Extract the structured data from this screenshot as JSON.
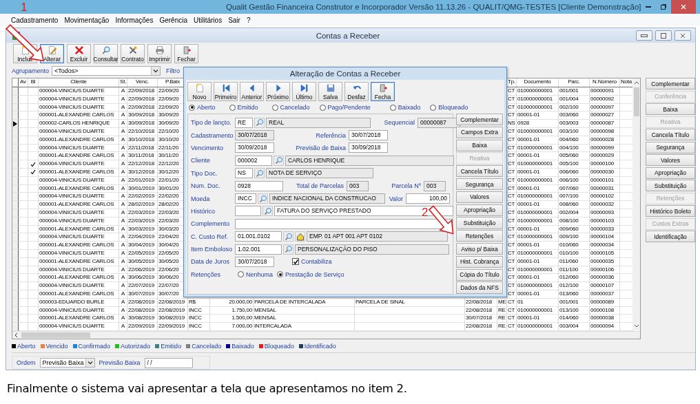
{
  "window": {
    "title": "Qualit Gestão Financeira Construtor e Incorporador Versão 11.13.26 - QUALIT/QMG-TESTES [Cliente Demonstração]"
  },
  "menu": [
    "Cadastramento",
    "Movimentação",
    "Informações",
    "Gerência",
    "Utilitários",
    "Sair",
    "?"
  ],
  "child_window": {
    "title": "Contas a Receber"
  },
  "toolbar": [
    {
      "label": "Incluir",
      "focused": false
    },
    {
      "label": "Alterar",
      "focused": true
    },
    {
      "label": "Excluir",
      "focused": false
    },
    {
      "label": "Consultar",
      "focused": false
    },
    {
      "label": "Contrato",
      "focused": false
    },
    {
      "label": "Imprimir",
      "focused": false
    },
    {
      "label": "Fechar",
      "focused": false
    }
  ],
  "filter": {
    "label": "Agrupamento",
    "value": "<Todos>",
    "filter_label": "Filtro"
  },
  "table": {
    "columns": [
      "Av",
      "Bl",
      "Cliente",
      "St.",
      "Venc.",
      "P.Baix",
      "",
      "",
      "",
      "",
      "",
      "",
      "Tp.",
      "Documento",
      "Parc.",
      "N.Número",
      "Nota"
    ],
    "rows": [
      {
        "selected": false,
        "blocked": false,
        "cells": [
          "",
          "",
          "000004-VINICIUS DUARTE",
          "A",
          "22/09/2018",
          "22/09/20",
          "",
          "",
          "",
          "",
          "",
          "",
          "CT",
          "010000000001",
          "001/001",
          "00000091"
        ]
      },
      {
        "selected": false,
        "blocked": false,
        "cells": [
          "",
          "",
          "000004-VINICIUS DUARTE",
          "A",
          "22/09/2018",
          "22/09/20",
          "",
          "",
          "",
          "",
          "",
          "",
          "CT",
          "010000000001",
          "001/004",
          "00000092"
        ]
      },
      {
        "selected": false,
        "blocked": false,
        "cells": [
          "",
          "",
          "000004-VINICIUS DUARTE",
          "A",
          "22/09/2018",
          "22/09/20",
          "",
          "",
          "",
          "",
          "",
          "",
          "CT",
          "010000000001",
          "002/100",
          "00000097"
        ]
      },
      {
        "selected": false,
        "blocked": false,
        "cells": [
          "",
          "",
          "000001-ALEXANDRE CARLOS",
          "A",
          "30/09/2018",
          "30/09/20",
          "",
          "",
          "",
          "",
          "",
          "",
          "CT",
          "00001-01",
          "003/060",
          "00000027"
        ]
      },
      {
        "selected": true,
        "blocked": false,
        "cells": [
          "",
          "",
          "000002-CARLOS HENRIQUE",
          "A",
          "30/09/2018",
          "30/09/20",
          "",
          "",
          "",
          "",
          "",
          "",
          "NS",
          "0928",
          "003/003",
          "00000087"
        ]
      },
      {
        "selected": false,
        "blocked": false,
        "cells": [
          "",
          "",
          "000004-VINICIUS DUARTE",
          "A",
          "22/10/2018",
          "22/10/20",
          "",
          "",
          "",
          "",
          "",
          "",
          "CT",
          "010000000001",
          "003/100",
          "00000098"
        ]
      },
      {
        "selected": false,
        "blocked": false,
        "cells": [
          "",
          "",
          "000001-ALEXANDRE CARLOS",
          "A",
          "30/10/2018",
          "30/10/20",
          "",
          "",
          "",
          "",
          "",
          "",
          "CT",
          "00001-01",
          "004/060",
          "00000028"
        ]
      },
      {
        "selected": false,
        "blocked": false,
        "cells": [
          "",
          "",
          "000004-VINICIUS DUARTE",
          "A",
          "22/11/2018",
          "22/11/20",
          "",
          "",
          "",
          "",
          "",
          "",
          "CT",
          "010000000001",
          "004/100",
          "00000099"
        ]
      },
      {
        "selected": false,
        "blocked": false,
        "cells": [
          "",
          "",
          "000001-ALEXANDRE CARLOS",
          "A",
          "30/11/2018",
          "30/11/20",
          "",
          "",
          "",
          "",
          "",
          "",
          "CT",
          "00001-01",
          "005/060",
          "00000029"
        ]
      },
      {
        "selected": false,
        "blocked": true,
        "cells": [
          "",
          "",
          "000004-VINICIUS DUARTE",
          "A",
          "22/12/2018",
          "22/12/20",
          "",
          "",
          "",
          "",
          "",
          "",
          "CT",
          "010000000001",
          "005/100",
          "00000100"
        ]
      },
      {
        "selected": false,
        "blocked": true,
        "cells": [
          "",
          "",
          "000001-ALEXANDRE CARLOS",
          "A",
          "30/12/2018",
          "30/12/20",
          "",
          "",
          "",
          "",
          "",
          "",
          "CT",
          "00001-01",
          "006/060",
          "00000030"
        ]
      },
      {
        "selected": false,
        "blocked": false,
        "cells": [
          "",
          "",
          "000004-VINICIUS DUARTE",
          "A",
          "22/01/2019",
          "22/01/20",
          "",
          "",
          "",
          "",
          "",
          "",
          "CT",
          "010000000001",
          "006/100",
          "00000101"
        ]
      },
      {
        "selected": false,
        "blocked": false,
        "cells": [
          "",
          "",
          "000001-ALEXANDRE CARLOS",
          "A",
          "30/01/2019",
          "30/01/20",
          "",
          "",
          "",
          "",
          "",
          "",
          "CT",
          "00001-01",
          "007/060",
          "00000031"
        ]
      },
      {
        "selected": false,
        "blocked": false,
        "cells": [
          "",
          "",
          "000004-VINICIUS DUARTE",
          "A",
          "22/02/2019",
          "22/02/20",
          "",
          "",
          "",
          "",
          "",
          "",
          "CT",
          "010000000001",
          "007/100",
          "00000102"
        ]
      },
      {
        "selected": false,
        "blocked": false,
        "cells": [
          "",
          "",
          "000001-ALEXANDRE CARLOS",
          "A",
          "28/02/2019",
          "28/02/20",
          "",
          "",
          "",
          "",
          "",
          "",
          "CT",
          "00001-01",
          "008/060",
          "00000032"
        ]
      },
      {
        "selected": false,
        "blocked": false,
        "cells": [
          "",
          "",
          "000004-VINICIUS DUARTE",
          "A",
          "22/03/2019",
          "22/03/20",
          "",
          "",
          "",
          "",
          "",
          "",
          "CT",
          "010000000001",
          "002/004",
          "00000093"
        ]
      },
      {
        "selected": false,
        "blocked": false,
        "cells": [
          "",
          "",
          "000004-VINICIUS DUARTE",
          "A",
          "22/03/2019",
          "22/03/20",
          "",
          "",
          "",
          "",
          "",
          "",
          "CT",
          "010000000001",
          "008/100",
          "00000103"
        ]
      },
      {
        "selected": false,
        "blocked": false,
        "cells": [
          "",
          "",
          "000001-ALEXANDRE CARLOS",
          "A",
          "30/03/2019",
          "30/03/20",
          "",
          "",
          "",
          "",
          "",
          "",
          "CT",
          "00001-01",
          "009/060",
          "00000033"
        ]
      },
      {
        "selected": false,
        "blocked": false,
        "cells": [
          "",
          "",
          "000004-VINICIUS DUARTE",
          "A",
          "22/04/2019",
          "22/04/20",
          "",
          "",
          "",
          "",
          "",
          "",
          "CT",
          "010000000001",
          "009/100",
          "00000104"
        ]
      },
      {
        "selected": false,
        "blocked": false,
        "cells": [
          "",
          "",
          "000001-ALEXANDRE CARLOS",
          "A",
          "30/04/2019",
          "30/04/20",
          "",
          "",
          "",
          "",
          "",
          "",
          "CT",
          "00001-01",
          "010/060",
          "00000034"
        ]
      },
      {
        "selected": false,
        "blocked": false,
        "cells": [
          "",
          "",
          "000004-VINICIUS DUARTE",
          "A",
          "22/05/2019",
          "22/05/20",
          "",
          "",
          "",
          "",
          "",
          "",
          "CT",
          "010000000001",
          "010/100",
          "00000105"
        ]
      },
      {
        "selected": false,
        "blocked": false,
        "cells": [
          "",
          "",
          "000001-ALEXANDRE CARLOS",
          "A",
          "30/05/2019",
          "30/05/20",
          "",
          "",
          "",
          "",
          "",
          "",
          "CT",
          "00001-01",
          "011/060",
          "00000035"
        ]
      },
      {
        "selected": false,
        "blocked": false,
        "cells": [
          "",
          "",
          "000004-VINICIUS DUARTE",
          "A",
          "22/06/2019",
          "22/06/20",
          "",
          "",
          "",
          "",
          "",
          "",
          "CT",
          "010000000001",
          "011/100",
          "00000106"
        ]
      },
      {
        "selected": false,
        "blocked": false,
        "cells": [
          "",
          "",
          "000001-ALEXANDRE CARLOS",
          "A",
          "30/06/2019",
          "30/06/20",
          "",
          "",
          "",
          "",
          "",
          "",
          "CT",
          "00001-01",
          "012/060",
          "00000036"
        ]
      },
      {
        "selected": false,
        "blocked": false,
        "cells": [
          "",
          "",
          "000004-VINICIUS DUARTE",
          "A",
          "22/07/2019",
          "22/07/20",
          "",
          "",
          "",
          "",
          "",
          "",
          "CT",
          "010000000001",
          "012/100",
          "00000107"
        ]
      },
      {
        "selected": false,
        "blocked": false,
        "cells": [
          "",
          "",
          "000001-ALEXANDRE CARLOS",
          "A",
          "30/07/2019",
          "30/07/20",
          "",
          "",
          "",
          "",
          "",
          "",
          "CT",
          "00001-01",
          "013/060",
          "00000037"
        ]
      },
      {
        "selected": false,
        "blocked": false,
        "cells": [
          "",
          "",
          "000003-EDUARDO BURLE",
          "A",
          "22/08/2019",
          "22/08/2019",
          "R$",
          "20.000,00",
          "PARCELA DE INTERCALADA",
          "PARCELA DE SINAL",
          "22/08/2018",
          "ME",
          "CT",
          "01",
          "001/001",
          "00000089"
        ]
      },
      {
        "selected": false,
        "blocked": false,
        "cells": [
          "",
          "",
          "000004-VINICIUS DUARTE",
          "A",
          "22/08/2019",
          "22/08/2019",
          "INCC",
          "1.750,00",
          "MENSAL",
          "",
          "22/08/2018",
          "RE",
          "CT",
          "010000000001",
          "013/100",
          "00000108"
        ]
      },
      {
        "selected": false,
        "blocked": false,
        "cells": [
          "",
          "",
          "000001-ALEXANDRE CARLOS",
          "A",
          "30/08/2019",
          "30/08/2019",
          "INCC",
          "1.500,00",
          "MENSAL",
          "",
          "30/07/2018",
          "RE",
          "CT",
          "00001-01",
          "014/060",
          "00000038"
        ]
      },
      {
        "selected": false,
        "blocked": false,
        "cells": [
          "",
          "",
          "000004-VINICIUS DUARTE",
          "A",
          "22/09/2019",
          "22/09/2019",
          "INCC",
          "7.000,00",
          "INTERCALADA",
          "",
          "22/08/2018",
          "RE",
          "CT",
          "010000000001",
          "003/004",
          "00000094"
        ]
      }
    ]
  },
  "side_buttons": [
    {
      "label": "Complementar",
      "disabled": false
    },
    {
      "label": "Conferência",
      "disabled": true
    },
    {
      "label": "Baixa",
      "disabled": false
    },
    {
      "label": "Reativa",
      "disabled": true
    },
    {
      "label": "Cancela Título",
      "disabled": false
    },
    {
      "label": "Segurança",
      "disabled": false
    },
    {
      "label": "Valores",
      "disabled": false
    },
    {
      "label": "Apropriação",
      "disabled": false
    },
    {
      "label": "Substituição",
      "disabled": false
    },
    {
      "label": "Retenções",
      "disabled": true
    },
    {
      "label": "Histórico Boleto",
      "disabled": false
    },
    {
      "label": "Custos Extras",
      "disabled": true
    },
    {
      "label": "Identificação",
      "disabled": false
    }
  ],
  "legend": [
    {
      "label": "Aberto",
      "color": "#000000"
    },
    {
      "label": "Vencido",
      "color": "#f08040"
    },
    {
      "label": "Confirmado",
      "color": "#2080e0"
    },
    {
      "label": "Autorizado",
      "color": "#20c020"
    },
    {
      "label": "Emitido",
      "color": "#408080"
    },
    {
      "label": "Cancelado",
      "color": "#808080"
    },
    {
      "label": "Baixado",
      "color": "#000080"
    },
    {
      "label": "Bloqueado",
      "color": "#e02020"
    },
    {
      "label": "Identificado",
      "color": "#204060"
    }
  ],
  "order": {
    "label": "Ordem",
    "value": "Previsão Baixa",
    "date_label": "Previsão Baixa",
    "date_value": "/ /"
  },
  "dialog": {
    "title": "Alteração de Contas a Receber",
    "toolbar": [
      {
        "label": "Novo",
        "focused": false
      },
      {
        "label": "Primeiro",
        "focused": false
      },
      {
        "label": "Anterior",
        "focused": false
      },
      {
        "label": "Próximo",
        "focused": false
      },
      {
        "label": "Último",
        "focused": false
      },
      {
        "label": "Salva",
        "focused": false
      },
      {
        "label": "Desfaz",
        "focused": false
      },
      {
        "label": "Fecha",
        "focused": true
      }
    ],
    "statuses": [
      {
        "label": "Aberto",
        "selected": true
      },
      {
        "label": "Emitido",
        "selected": false
      },
      {
        "label": "Cancelado",
        "selected": false
      },
      {
        "label": "Pago/Pendente",
        "selected": false
      },
      {
        "label": "Baixado",
        "selected": false
      },
      {
        "label": "Bloqueado",
        "selected": false
      }
    ],
    "form": {
      "tipo_lancto": {
        "label": "Tipo de lançto.",
        "code": "RE",
        "description": "REAL"
      },
      "sequencial": {
        "label": "Sequencial",
        "value": "00000087",
        "readonly": true
      },
      "cadastramento": {
        "label": "Cadastramento",
        "value": "30/07/2018",
        "readonly": true
      },
      "referencia": {
        "label": "Referência",
        "value": "30/07/2018",
        "readonly": false
      },
      "vencimento": {
        "label": "Vencimento",
        "value": "30/09/2018",
        "readonly": false
      },
      "previsao_baixa": {
        "label": "Previsão de Baixa",
        "value": "30/09/2018",
        "readonly": false
      },
      "cliente": {
        "label": "Cliente",
        "code": "000002",
        "description": "CARLOS HENRIQUE"
      },
      "tipo_doc": {
        "label": "Tipo Doc.",
        "code": "NS",
        "description": "NOTA DE SERVIÇO"
      },
      "num_doc": {
        "label": "Num. Doc.",
        "value": "0928",
        "readonly": false
      },
      "total_parcelas": {
        "label": "Total de Parcelas",
        "value": "003",
        "readonly": true
      },
      "parcela": {
        "label": "Parcela Nº",
        "value": "003",
        "readonly": true
      },
      "moeda": {
        "label": "Moeda",
        "code": "INCC",
        "description": "INDICE NACIONAL DA CONSTRUCAO"
      },
      "valor": {
        "label": "Valor",
        "value": "100,00",
        "readonly": false
      },
      "historico": {
        "label": "Histórico",
        "description": "FATURA DO SERVIÇO PRESTADO"
      },
      "complemento": {
        "label": "Complemento"
      },
      "c_custo": {
        "label": "C. Custo Ref.",
        "code": "01.001.0102",
        "description": "EMP. 01 APT 001 APT 0102"
      },
      "item_emboloso": {
        "label": "Item Emboloso",
        "code": "1.02.001",
        "description": "PERSONALIZAÇÃO DO PISO"
      },
      "data_juros": {
        "label": "Data de Juros",
        "value": "30/07/2018",
        "readonly": false
      },
      "contabiliza": {
        "label": "Contabiliza",
        "checked": true
      },
      "retencoes": {
        "label": "Retenções",
        "options": [
          {
            "label": "Nenhuma",
            "selected": false
          },
          {
            "label": "Prestação de Serviço",
            "selected": true
          }
        ]
      }
    },
    "buttons": [
      {
        "label": "Complementar",
        "disabled": false
      },
      {
        "label": "Campos Extra",
        "disabled": false
      },
      {
        "label": "Baixa",
        "disabled": false
      },
      {
        "label": "Reativa",
        "disabled": true
      },
      {
        "label": "Cancela Título",
        "disabled": false
      },
      {
        "label": "Segurança",
        "disabled": false
      },
      {
        "label": "Valores",
        "disabled": false
      },
      {
        "label": "Apropriação",
        "disabled": false
      },
      {
        "label": "Substituição",
        "disabled": false
      },
      {
        "label": "Retenções",
        "disabled": false
      },
      {
        "label": "Aviso p/ Baixa",
        "disabled": false
      },
      {
        "label": "Hist. Cobrança",
        "disabled": false
      },
      {
        "label": "Cópia do Título",
        "disabled": false
      },
      {
        "label": "Dados da NFS",
        "disabled": false
      }
    ]
  },
  "annotations": [
    {
      "label": "1"
    },
    {
      "label": "2"
    }
  ],
  "caption": "Finalmente o sistema vai apresentar a tela que apresentamos no item 2."
}
